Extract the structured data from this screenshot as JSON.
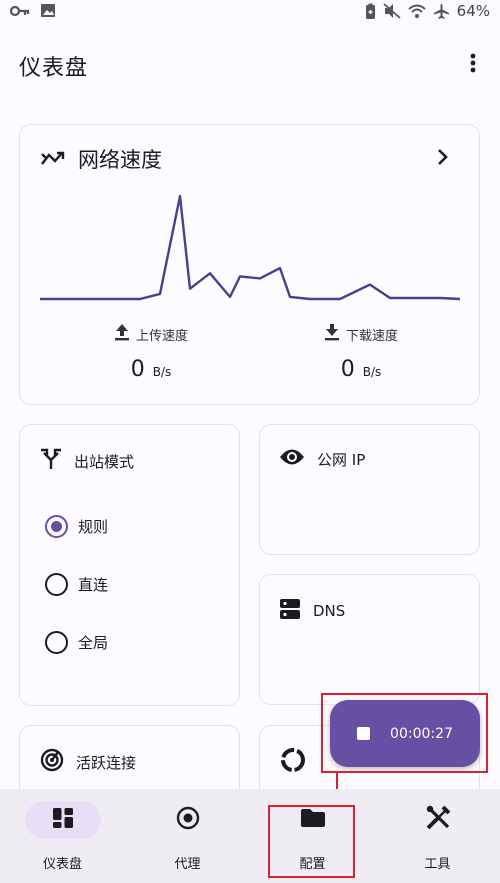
{
  "status_bar": {
    "battery_text": "64%",
    "icons": [
      "key-icon",
      "image-icon",
      "battery-saver-icon",
      "mute-icon",
      "wifi-icon",
      "airplane-icon"
    ]
  },
  "app_bar": {
    "title": "仪表盘",
    "menu_icon": "more-vert-icon"
  },
  "network_speed": {
    "title": "网络速度",
    "upload_label": "上传速度",
    "upload_value": "0",
    "upload_unit": "B/s",
    "download_label": "下载速度",
    "download_value": "0",
    "download_unit": "B/s",
    "accent": "#4e3d8c"
  },
  "chart_data": {
    "type": "line",
    "title": "",
    "xlabel": "",
    "ylabel": "",
    "grid": false,
    "x": [
      0,
      6,
      10,
      12,
      14,
      15,
      17,
      19,
      20,
      22,
      24,
      25,
      27,
      30,
      33,
      35,
      37,
      40,
      42
    ],
    "values": [
      0,
      0,
      0,
      0.05,
      1.0,
      0.1,
      0.25,
      0.02,
      0.22,
      0.2,
      0.3,
      0.02,
      0.0,
      0.0,
      0.14,
      0.01,
      0.01,
      0.01,
      0.0
    ],
    "ylim": [
      0,
      1.05
    ]
  },
  "outbound_mode": {
    "title": "出站模式",
    "options": [
      {
        "label": "规则",
        "selected": true
      },
      {
        "label": "直连",
        "selected": false
      },
      {
        "label": "全局",
        "selected": false
      }
    ]
  },
  "public_ip": {
    "title": "公网 IP"
  },
  "dns": {
    "title": "DNS"
  },
  "active_connections": {
    "title": "活跃连接"
  },
  "timer": {
    "elapsed": "00:00:27"
  },
  "bottom_nav": {
    "items": [
      {
        "label": "仪表盘",
        "icon": "dashboard-icon",
        "active": true
      },
      {
        "label": "代理",
        "icon": "proxy-icon",
        "active": false
      },
      {
        "label": "配置",
        "icon": "folder-icon",
        "active": false
      },
      {
        "label": "工具",
        "icon": "tools-icon",
        "active": false
      }
    ]
  },
  "colors": {
    "primary": "#6750a4",
    "highlight": "#e0202a",
    "nav_background": "#f0ecf4"
  }
}
